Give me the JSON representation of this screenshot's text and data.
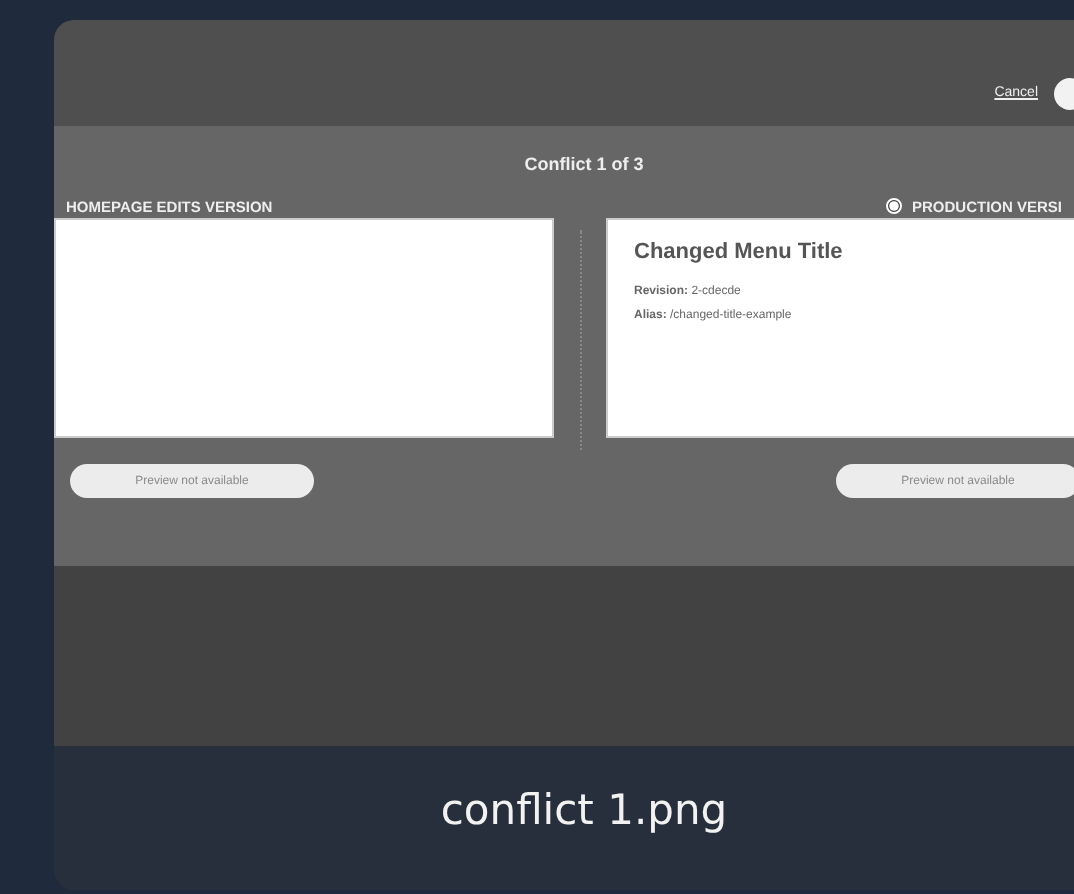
{
  "dialog": {
    "cancel_link": "Cancel",
    "counter": "Conflict 1 of 3"
  },
  "versions": [
    {
      "label": "HOMEPAGE EDITS VERSION",
      "preview_button": "Preview not available"
    },
    {
      "label": "PRODUCTION VERSI",
      "radio_selected": true,
      "title": "Changed Menu Title",
      "fields": [
        {
          "name": "Revision:",
          "value": "2-cdecde"
        },
        {
          "name": "Alias:",
          "value": "/changed-title-example"
        }
      ],
      "preview_button": "Preview not available"
    }
  ],
  "file_name": "conflict 1.png"
}
